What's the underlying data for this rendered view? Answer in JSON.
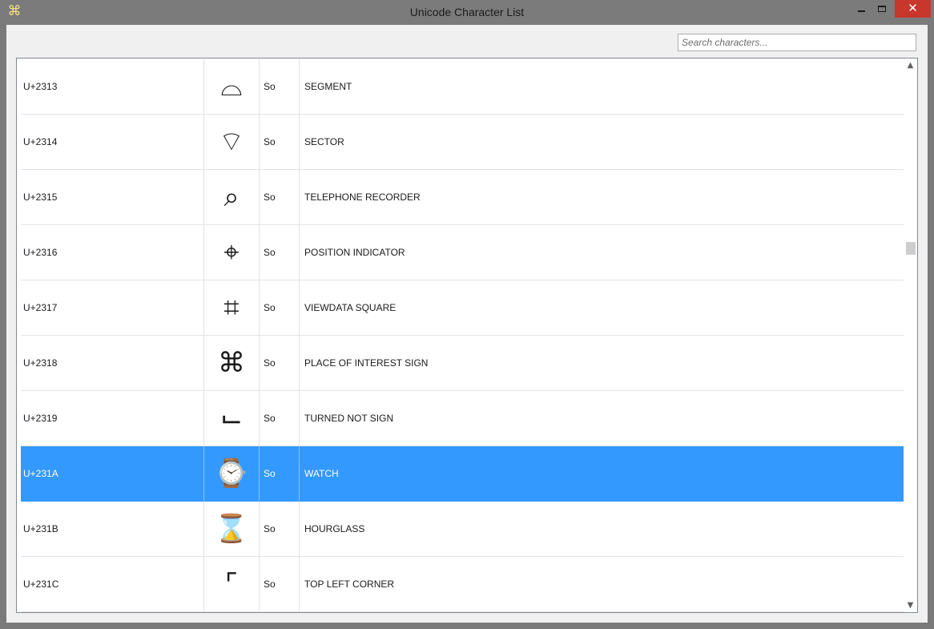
{
  "window": {
    "title": "Unicode Character List",
    "app_icon_glyph": "⌘",
    "minimize_label": "",
    "maximize_label": "",
    "close_label": "✕"
  },
  "search": {
    "placeholder": "Search characters...",
    "value": ""
  },
  "table": {
    "selected_index": 7,
    "rows": [
      {
        "code": "U+2313",
        "glyph": "⌓",
        "category": "So",
        "name": "SEGMENT"
      },
      {
        "code": "U+2314",
        "glyph": "⌔",
        "category": "So",
        "name": "SECTOR"
      },
      {
        "code": "U+2315",
        "glyph": "⌕",
        "category": "So",
        "name": "TELEPHONE RECORDER"
      },
      {
        "code": "U+2316",
        "glyph": "⌖",
        "category": "So",
        "name": "POSITION INDICATOR"
      },
      {
        "code": "U+2317",
        "glyph": "⌗",
        "category": "So",
        "name": "VIEWDATA SQUARE"
      },
      {
        "code": "U+2318",
        "glyph": "⌘",
        "category": "So",
        "name": "PLACE OF INTEREST SIGN"
      },
      {
        "code": "U+2319",
        "glyph": "⌙",
        "category": "So",
        "name": "TURNED NOT SIGN"
      },
      {
        "code": "U+231A",
        "glyph": "⌚",
        "category": "So",
        "name": "WATCH"
      },
      {
        "code": "U+231B",
        "glyph": "⌛",
        "category": "So",
        "name": "HOURGLASS"
      },
      {
        "code": "U+231C",
        "glyph": "⌜",
        "category": "So",
        "name": "TOP LEFT CORNER"
      }
    ]
  },
  "scrollbar": {
    "up_glyph": "▲",
    "down_glyph": "▼",
    "scroll_position": 0.33
  },
  "colors": {
    "selection": "#3399ff",
    "close_button": "#c7372b"
  }
}
